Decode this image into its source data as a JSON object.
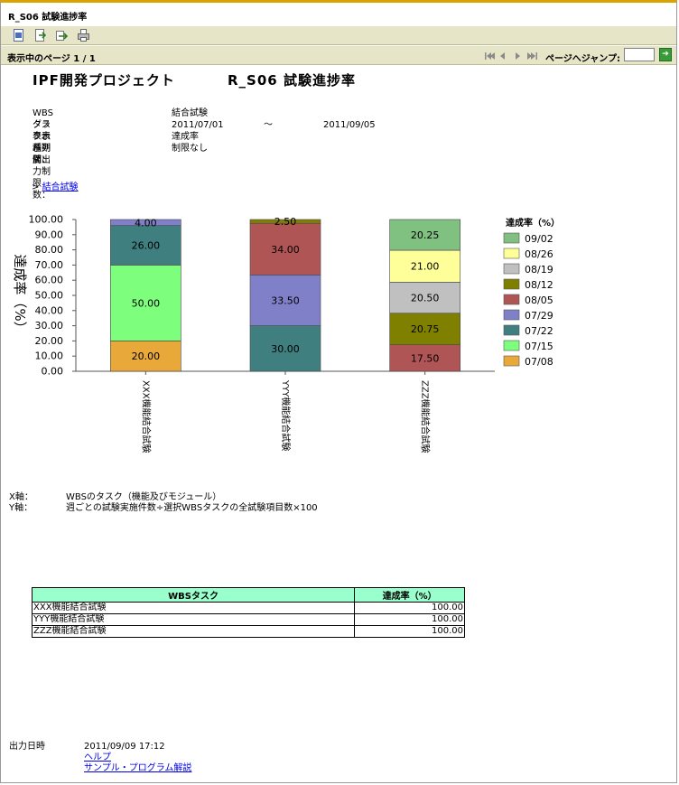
{
  "window": {
    "title": "R_S06 試験進捗率"
  },
  "toolbar": {
    "icons": [
      "export-pdf-icon",
      "export-file-icon",
      "export-arrow-icon",
      "print-icon"
    ]
  },
  "nav": {
    "page_label": "表示中のページ 1 / 1",
    "jump_label": "ページへジャンプ:",
    "jump_value": ""
  },
  "report": {
    "project": "IPF開発プロジェクト",
    "title": "R_S06 試験進捗率",
    "params": [
      {
        "key": "WBSタスク：",
        "value": "結合試験"
      },
      {
        "key": "グラフ表示期間：",
        "value": "2011/07/01",
        "tilde": "～",
        "value2": "2011/09/05"
      },
      {
        "key": "表示種別：",
        "value": "達成率"
      },
      {
        "key": "系列値出力制限数：",
        "value": "制限なし"
      }
    ],
    "breadcrumb_prefix": "> ",
    "breadcrumb_link": "結合試験"
  },
  "chart_data": {
    "type": "bar",
    "stacked": true,
    "ylabel": "達成率（%）",
    "ylim": [
      0,
      100
    ],
    "yticks": [
      "0.00",
      "10.00",
      "20.00",
      "30.00",
      "40.00",
      "50.00",
      "60.00",
      "70.00",
      "80.00",
      "90.00",
      "100.00"
    ],
    "categories": [
      "XXX機能結合試験",
      "YYY機能結合試験",
      "ZZZ機能結合試験"
    ],
    "legend_title": "達成率（%）",
    "legend_position": "right",
    "series": [
      {
        "name": "07/08",
        "color": "#e8a83a",
        "values": [
          20.0,
          0,
          0
        ]
      },
      {
        "name": "07/15",
        "color": "#7dff7d",
        "values": [
          50.0,
          0,
          0
        ]
      },
      {
        "name": "07/22",
        "color": "#3f7f7f",
        "values": [
          26.0,
          30.0,
          0
        ]
      },
      {
        "name": "07/29",
        "color": "#8080c8",
        "values": [
          4.0,
          33.5,
          0
        ]
      },
      {
        "name": "08/05",
        "color": "#b05555",
        "values": [
          0,
          34.0,
          17.5
        ]
      },
      {
        "name": "08/12",
        "color": "#808000",
        "values": [
          0,
          2.5,
          20.75
        ]
      },
      {
        "name": "08/19",
        "color": "#c0c0c0",
        "values": [
          0,
          0,
          20.5
        ]
      },
      {
        "name": "08/26",
        "color": "#ffff99",
        "values": [
          0,
          0,
          21.0
        ]
      },
      {
        "name": "09/02",
        "color": "#80c080",
        "values": [
          0,
          0,
          20.25
        ]
      }
    ]
  },
  "axis_desc": [
    {
      "key": "X軸：",
      "value": "WBSのタスク（機能及びモジュール）"
    },
    {
      "key": "Y軸：",
      "value": "週ごとの試験実施件数÷選択WBSタスクの全試験項目数×100"
    }
  ],
  "table": {
    "headers": [
      "WBSタスク",
      "達成率（%）"
    ],
    "rows": [
      [
        "XXX機能結合試験",
        "100.00"
      ],
      [
        "YYY機能結合試験",
        "100.00"
      ],
      [
        "ZZZ機能結合試験",
        "100.00"
      ]
    ]
  },
  "footer": {
    "label": "出力日時",
    "datetime": "2011/09/09 17:12",
    "help_link": "ヘルプ",
    "sample_link": "サンプル・プログラム解説"
  }
}
